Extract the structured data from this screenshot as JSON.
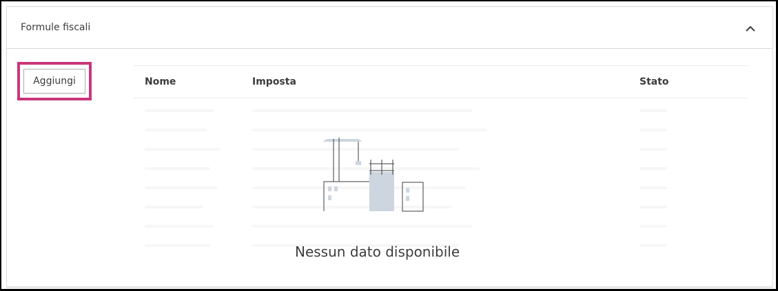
{
  "panel": {
    "title": "Formule fiscali",
    "collapse_icon": "chevron-up-icon"
  },
  "toolbar": {
    "add_label": "Aggiungi"
  },
  "table": {
    "columns": [
      "Nome",
      "Imposta",
      "Stato"
    ],
    "rows": []
  },
  "empty_state": {
    "message": "Nessun dato disponibile",
    "illustration": "construction-site-illustration"
  },
  "colors": {
    "highlight": "#c8367a",
    "illustration_fill": "#cdd6df",
    "illustration_stroke": "#3c3c3c",
    "border": "#d9d9d9"
  }
}
